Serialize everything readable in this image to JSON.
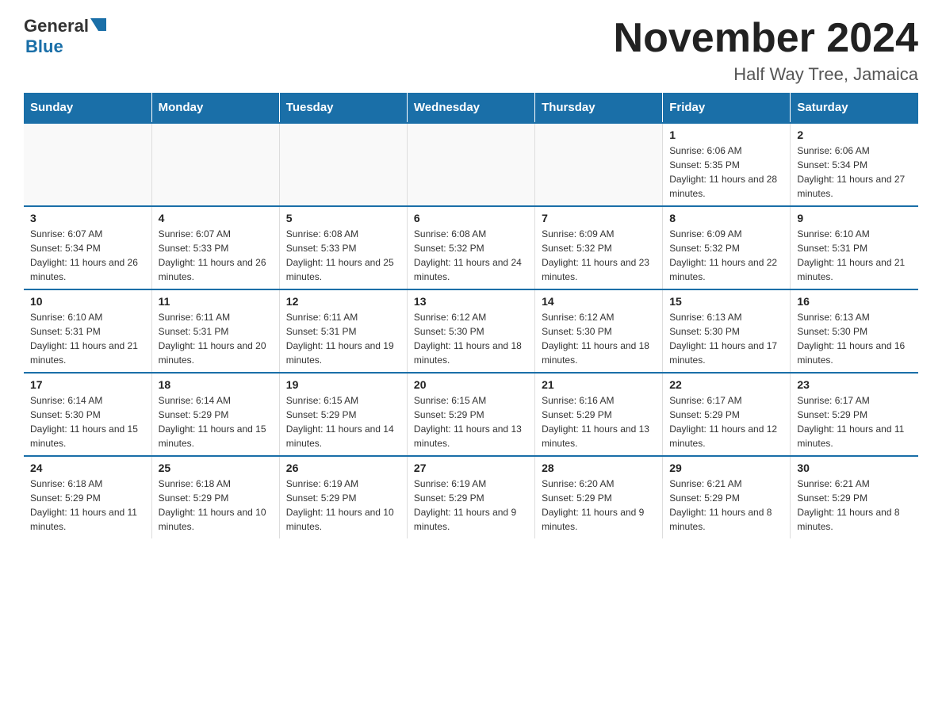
{
  "logo": {
    "general": "General",
    "blue": "Blue"
  },
  "title": "November 2024",
  "location": "Half Way Tree, Jamaica",
  "days_of_week": [
    "Sunday",
    "Monday",
    "Tuesday",
    "Wednesday",
    "Thursday",
    "Friday",
    "Saturday"
  ],
  "weeks": [
    [
      {
        "day": "",
        "info": ""
      },
      {
        "day": "",
        "info": ""
      },
      {
        "day": "",
        "info": ""
      },
      {
        "day": "",
        "info": ""
      },
      {
        "day": "",
        "info": ""
      },
      {
        "day": "1",
        "info": "Sunrise: 6:06 AM\nSunset: 5:35 PM\nDaylight: 11 hours and 28 minutes."
      },
      {
        "day": "2",
        "info": "Sunrise: 6:06 AM\nSunset: 5:34 PM\nDaylight: 11 hours and 27 minutes."
      }
    ],
    [
      {
        "day": "3",
        "info": "Sunrise: 6:07 AM\nSunset: 5:34 PM\nDaylight: 11 hours and 26 minutes."
      },
      {
        "day": "4",
        "info": "Sunrise: 6:07 AM\nSunset: 5:33 PM\nDaylight: 11 hours and 26 minutes."
      },
      {
        "day": "5",
        "info": "Sunrise: 6:08 AM\nSunset: 5:33 PM\nDaylight: 11 hours and 25 minutes."
      },
      {
        "day": "6",
        "info": "Sunrise: 6:08 AM\nSunset: 5:32 PM\nDaylight: 11 hours and 24 minutes."
      },
      {
        "day": "7",
        "info": "Sunrise: 6:09 AM\nSunset: 5:32 PM\nDaylight: 11 hours and 23 minutes."
      },
      {
        "day": "8",
        "info": "Sunrise: 6:09 AM\nSunset: 5:32 PM\nDaylight: 11 hours and 22 minutes."
      },
      {
        "day": "9",
        "info": "Sunrise: 6:10 AM\nSunset: 5:31 PM\nDaylight: 11 hours and 21 minutes."
      }
    ],
    [
      {
        "day": "10",
        "info": "Sunrise: 6:10 AM\nSunset: 5:31 PM\nDaylight: 11 hours and 21 minutes."
      },
      {
        "day": "11",
        "info": "Sunrise: 6:11 AM\nSunset: 5:31 PM\nDaylight: 11 hours and 20 minutes."
      },
      {
        "day": "12",
        "info": "Sunrise: 6:11 AM\nSunset: 5:31 PM\nDaylight: 11 hours and 19 minutes."
      },
      {
        "day": "13",
        "info": "Sunrise: 6:12 AM\nSunset: 5:30 PM\nDaylight: 11 hours and 18 minutes."
      },
      {
        "day": "14",
        "info": "Sunrise: 6:12 AM\nSunset: 5:30 PM\nDaylight: 11 hours and 18 minutes."
      },
      {
        "day": "15",
        "info": "Sunrise: 6:13 AM\nSunset: 5:30 PM\nDaylight: 11 hours and 17 minutes."
      },
      {
        "day": "16",
        "info": "Sunrise: 6:13 AM\nSunset: 5:30 PM\nDaylight: 11 hours and 16 minutes."
      }
    ],
    [
      {
        "day": "17",
        "info": "Sunrise: 6:14 AM\nSunset: 5:30 PM\nDaylight: 11 hours and 15 minutes."
      },
      {
        "day": "18",
        "info": "Sunrise: 6:14 AM\nSunset: 5:29 PM\nDaylight: 11 hours and 15 minutes."
      },
      {
        "day": "19",
        "info": "Sunrise: 6:15 AM\nSunset: 5:29 PM\nDaylight: 11 hours and 14 minutes."
      },
      {
        "day": "20",
        "info": "Sunrise: 6:15 AM\nSunset: 5:29 PM\nDaylight: 11 hours and 13 minutes."
      },
      {
        "day": "21",
        "info": "Sunrise: 6:16 AM\nSunset: 5:29 PM\nDaylight: 11 hours and 13 minutes."
      },
      {
        "day": "22",
        "info": "Sunrise: 6:17 AM\nSunset: 5:29 PM\nDaylight: 11 hours and 12 minutes."
      },
      {
        "day": "23",
        "info": "Sunrise: 6:17 AM\nSunset: 5:29 PM\nDaylight: 11 hours and 11 minutes."
      }
    ],
    [
      {
        "day": "24",
        "info": "Sunrise: 6:18 AM\nSunset: 5:29 PM\nDaylight: 11 hours and 11 minutes."
      },
      {
        "day": "25",
        "info": "Sunrise: 6:18 AM\nSunset: 5:29 PM\nDaylight: 11 hours and 10 minutes."
      },
      {
        "day": "26",
        "info": "Sunrise: 6:19 AM\nSunset: 5:29 PM\nDaylight: 11 hours and 10 minutes."
      },
      {
        "day": "27",
        "info": "Sunrise: 6:19 AM\nSunset: 5:29 PM\nDaylight: 11 hours and 9 minutes."
      },
      {
        "day": "28",
        "info": "Sunrise: 6:20 AM\nSunset: 5:29 PM\nDaylight: 11 hours and 9 minutes."
      },
      {
        "day": "29",
        "info": "Sunrise: 6:21 AM\nSunset: 5:29 PM\nDaylight: 11 hours and 8 minutes."
      },
      {
        "day": "30",
        "info": "Sunrise: 6:21 AM\nSunset: 5:29 PM\nDaylight: 11 hours and 8 minutes."
      }
    ]
  ]
}
